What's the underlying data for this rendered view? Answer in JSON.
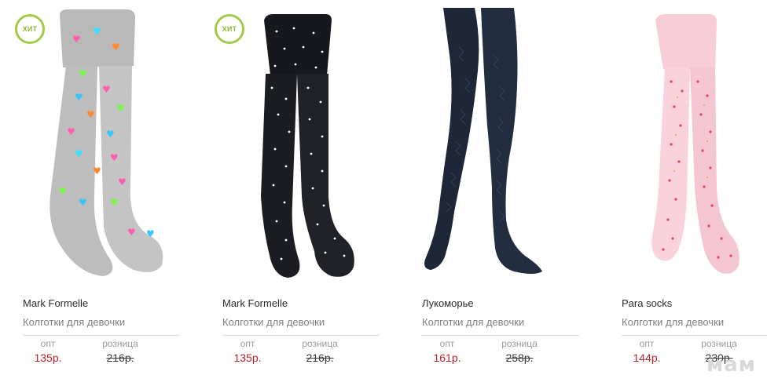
{
  "products": [
    {
      "badge": "ХИТ",
      "brand": "Mark Formelle",
      "category": "Колготки для девочки",
      "opt_label": "опт",
      "retail_label": "розница",
      "opt_price": "135р.",
      "retail_price": "216р.",
      "image": "grey-tights-with-colored-hearts"
    },
    {
      "badge": "ХИТ",
      "brand": "Mark Formelle",
      "category": "Колготки для девочки",
      "opt_label": "опт",
      "retail_label": "розница",
      "opt_price": "135р.",
      "retail_price": "216р.",
      "image": "black-tights-with-white-dots"
    },
    {
      "brand": "Лукоморье",
      "category": "Колготки для девочки",
      "opt_label": "опт",
      "retail_label": "розница",
      "opt_price": "161р.",
      "retail_price": "258р.",
      "image": "navy-openwork-tights-on-legs"
    },
    {
      "brand": "Para socks",
      "category": "Колготки для девочки",
      "opt_label": "опт",
      "retail_label": "розница",
      "opt_price": "144р.",
      "retail_price": "230р.",
      "image": "pink-tights-with-strawberries"
    }
  ],
  "watermark": "мам",
  "colors": {
    "price_red": "#b5232f",
    "badge_green": "#a3c94a"
  }
}
